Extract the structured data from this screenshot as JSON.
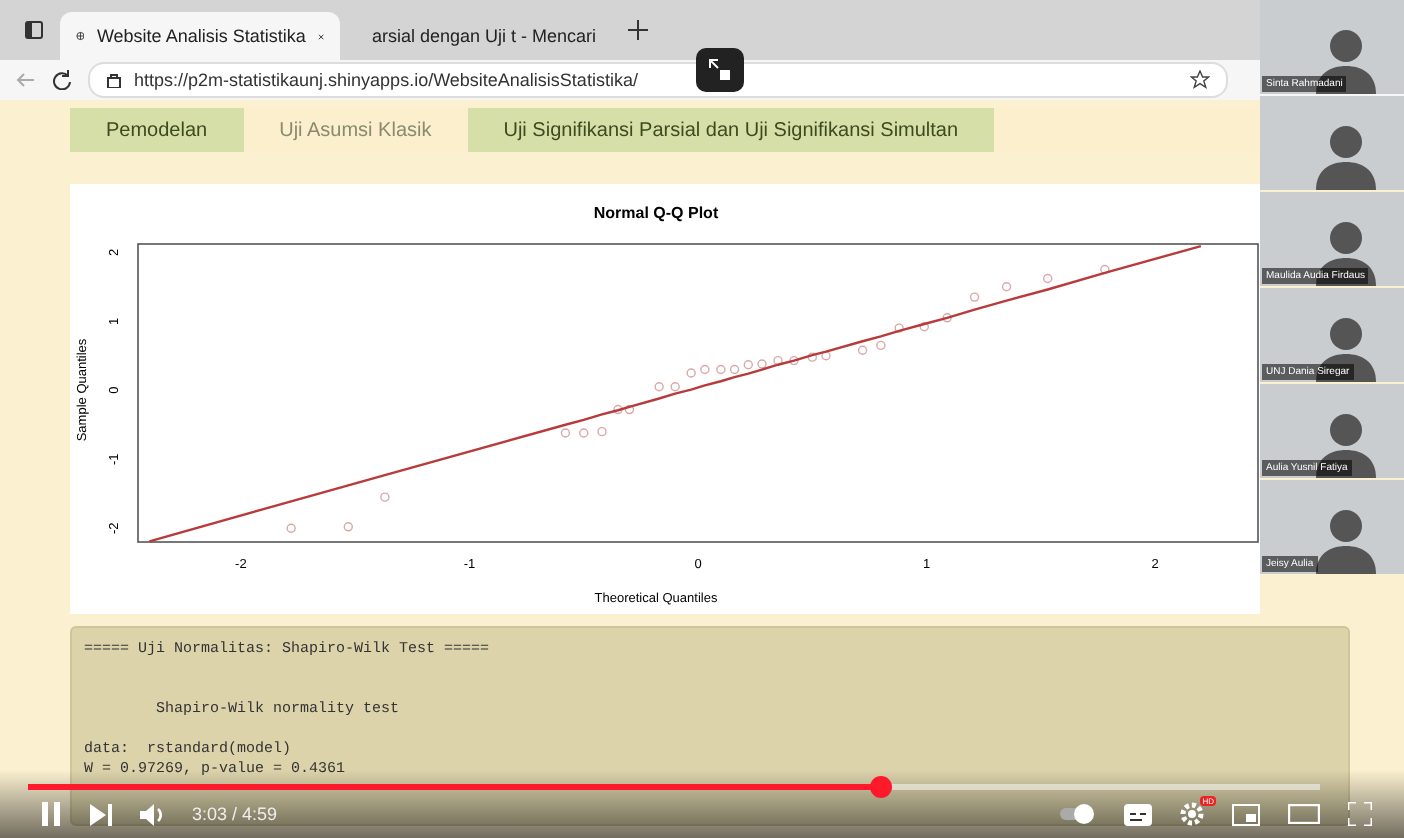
{
  "browser": {
    "tabs": [
      {
        "title": "Website Analisis Statistika",
        "selected": true
      },
      {
        "title": "arsial dengan Uji t - Mencari",
        "selected": false
      }
    ],
    "url": "https://p2m-statistikaunj.shinyapps.io/WebsiteAnalisisStatistika/"
  },
  "app_tabs": [
    {
      "label": "Pemodelan",
      "selected": false
    },
    {
      "label": "Uji Asumsi Klasik",
      "selected": true
    },
    {
      "label": "Uji Signifikansi Parsial dan Uji Signifikansi Simultan",
      "selected": false
    }
  ],
  "plot": {
    "chart_data": {
      "type": "scatter",
      "title": "Normal Q-Q Plot",
      "xlabel": "Theoretical Quantiles",
      "ylabel": "Sample Quantiles",
      "x": [
        -2.4,
        -1.78,
        -1.53,
        -1.37,
        -0.58,
        -0.5,
        -0.42,
        -0.35,
        -0.3,
        -0.17,
        -0.1,
        -0.03,
        0.03,
        0.1,
        0.16,
        0.22,
        0.28,
        0.35,
        0.42,
        0.5,
        0.56,
        0.72,
        0.8,
        0.88,
        0.99,
        1.09,
        1.21,
        1.35,
        1.53,
        1.78,
        2.2
      ],
      "series": [
        {
          "type": "scatter",
          "color": "#d8a8a8",
          "values": [
            null,
            -2.0,
            -1.98,
            -1.55,
            -0.62,
            -0.62,
            -0.6,
            -0.28,
            -0.28,
            0.05,
            0.05,
            0.25,
            0.3,
            0.3,
            0.3,
            0.37,
            0.38,
            0.43,
            0.43,
            0.48,
            0.5,
            0.58,
            0.65,
            0.9,
            0.92,
            1.05,
            1.35,
            1.5,
            1.62,
            1.75,
            null
          ]
        },
        {
          "type": "line",
          "color": "#b83a3a",
          "values": [
            -2.19,
            -1.61,
            -1.38,
            -1.23,
            -0.5,
            -0.43,
            -0.35,
            -0.29,
            -0.24,
            -0.12,
            -0.05,
            0.01,
            0.07,
            0.13,
            0.19,
            0.24,
            0.3,
            0.37,
            0.43,
            0.51,
            0.56,
            0.71,
            0.78,
            0.86,
            0.96,
            1.05,
            1.17,
            1.3,
            1.46,
            1.7,
            2.09
          ]
        }
      ],
      "xlim": [
        -2.45,
        2.45
      ],
      "ylim": [
        -2.2,
        2.12
      ],
      "xticks": [
        -2,
        -1,
        0,
        1,
        2
      ],
      "yticks": [
        -2,
        -1,
        0,
        1,
        2
      ]
    }
  },
  "output": {
    "text": "===== Uji Normalitas: Shapiro-Wilk Test =====\n\n\n        Shapiro-Wilk normality test\n\ndata:  rstandard(model)\nW = 0.97269, p-value = 0.4361"
  },
  "participants": [
    {
      "name_tag": true,
      "name": "Sinta Rahmadani"
    },
    {
      "name_tag": false
    },
    {
      "name_tag": true,
      "name": "Maulida Audia Firdaus"
    },
    {
      "name_tag": true,
      "name": "UNJ Dania Siregar"
    },
    {
      "name_tag": true,
      "name": "Aulia Yusnil Fatiya"
    },
    {
      "name_tag": true,
      "name": "Jeisy Aulia"
    }
  ],
  "player": {
    "time": "3:03 / 4:59",
    "level": 0.66,
    "playing": true,
    "hd_badge": "HD"
  }
}
